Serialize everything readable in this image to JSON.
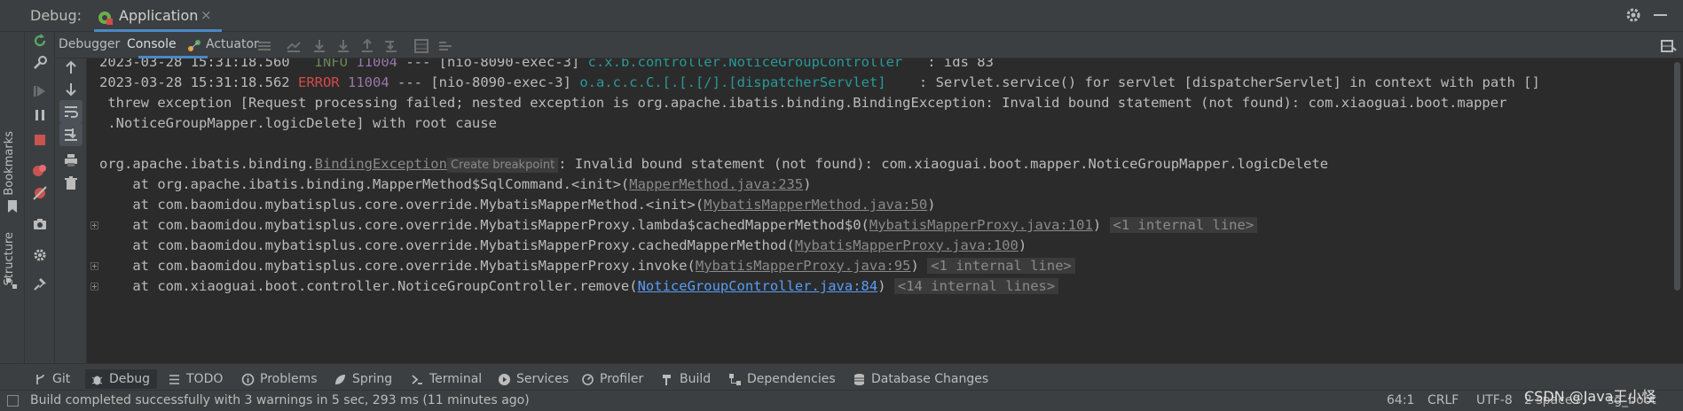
{
  "header": {
    "debug_label": "Debug:",
    "run_tab_label": "Application",
    "close_glyph": "×"
  },
  "side_strip": {
    "bookmarks": "Bookmarks",
    "structure": "Structure"
  },
  "subtabs": {
    "debugger": "Debugger",
    "console": "Console",
    "actuator": "Actuator"
  },
  "console": {
    "line1": {
      "timestamp": "2023-03-28 15:31:18.560",
      "level": " INFO",
      "pid": "11004",
      "thread": " --- [nio-8090-exec-3] ",
      "logger": "c.x.b.controller.NoticeGroupController  ",
      "message": " : ids 83"
    },
    "line2": {
      "timestamp": "2023-03-28 15:31:18.562",
      "level": "ERROR",
      "pid": "11004",
      "thread": " --- [nio-8090-exec-3] ",
      "logger": "o.a.c.c.C.[.[.[/].[dispatcherServlet]   ",
      "message": " : Servlet.service() for servlet [dispatcherServlet] in context with path []"
    },
    "line3": " threw exception [Request processing failed; nested exception is org.apache.ibatis.binding.BindingException: Invalid bound statement (not found): com.xiaoguai.boot.mapper",
    "line4": " .NoticeGroupMapper.logicDelete] with root cause",
    "exception_prefix": "org.apache.ibatis.binding.",
    "exception_class": "BindingException",
    "create_breakpoint": "Create breakpoint",
    "exception_message": ": Invalid bound statement (not found): com.xiaoguai.boot.mapper.NoticeGroupMapper.logicDelete",
    "frames": [
      {
        "text": "    at org.apache.ibatis.binding.MapperMethod$SqlCommand.<init>(",
        "link": "MapperMethod.java:235",
        "suffix": ")",
        "fold": ""
      },
      {
        "text": "    at com.baomidou.mybatisplus.core.override.MybatisMapperMethod.<init>(",
        "link": "MybatisMapperMethod.java:50",
        "suffix": ")",
        "fold": ""
      },
      {
        "text": "    at com.baomidou.mybatisplus.core.override.MybatisMapperProxy.lambda$cachedMapperMethod$0(",
        "link": "MybatisMapperProxy.java:101",
        "suffix": ")",
        "fold": "<1 internal line>"
      },
      {
        "text": "    at com.baomidou.mybatisplus.core.override.MybatisMapperProxy.cachedMapperMethod(",
        "link": "MybatisMapperProxy.java:100",
        "suffix": ")",
        "fold": ""
      },
      {
        "text": "    at com.baomidou.mybatisplus.core.override.MybatisMapperProxy.invoke(",
        "link": "MybatisMapperProxy.java:95",
        "suffix": ")",
        "fold": "<1 internal line>"
      },
      {
        "text": "    at com.xiaoguai.boot.controller.NoticeGroupController.remove(",
        "link": "NoticeGroupController.java:84",
        "suffix": ")",
        "fold": "<14 internal lines>"
      }
    ]
  },
  "bottom_tabs": {
    "git": "Git",
    "debug": "Debug",
    "todo": "TODO",
    "problems": "Problems",
    "spring": "Spring",
    "terminal": "Terminal",
    "services": "Services",
    "profiler": "Profiler",
    "build": "Build",
    "dependencies": "Dependencies",
    "database_changes": "Database Changes"
  },
  "status": {
    "message": "Build completed successfully with 3 warnings in 5 sec, 293 ms (11 minutes ago)",
    "position": "64:1",
    "line_sep": "CRLF",
    "encoding": "UTF-8",
    "indent": "2 spaces",
    "branch": "sg_boot"
  },
  "watermark": "CSDN @Java王小怪",
  "colors": {
    "accent": "#4a88c7",
    "error": "#d7494a",
    "info": "#6a8759",
    "logger": "#299999",
    "pid": "#9876aa",
    "link_blue": "#589df6"
  }
}
